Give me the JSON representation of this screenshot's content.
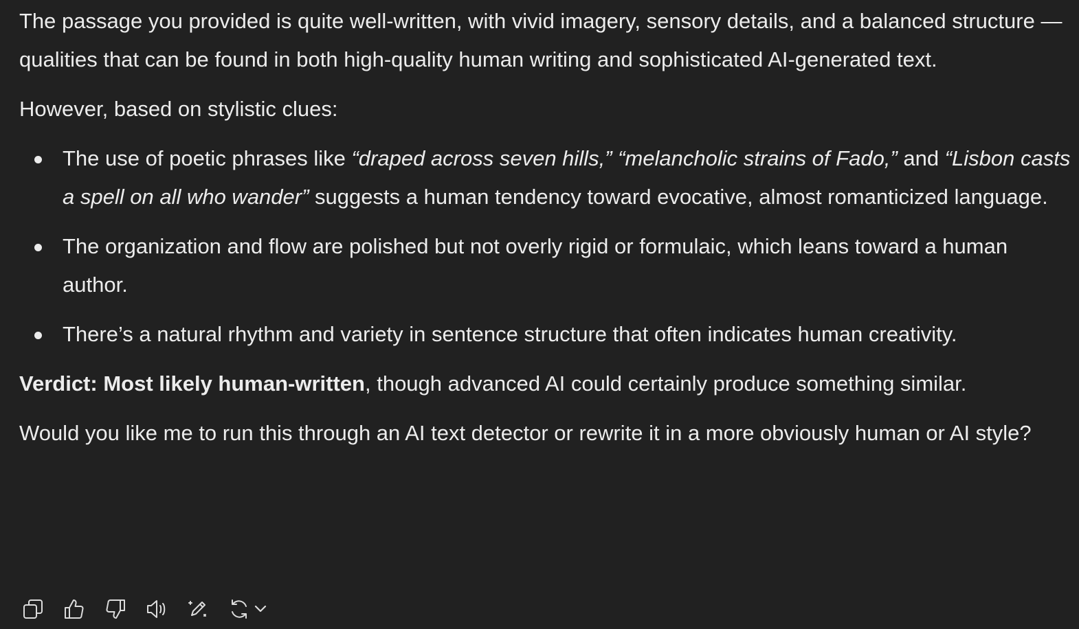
{
  "message": {
    "intro": "The passage you provided is quite well-written, with vivid imagery, sensory details, and a balanced structure — qualities that can be found in both high-quality human writing and sophisticated AI-generated text.",
    "however": "However, based on stylistic clues:",
    "bullets": [
      {
        "prefix": "The use of poetic phrases like ",
        "quote1": "“draped across seven hills,”",
        "sep1": " ",
        "quote2": "“melancholic strains of Fado,”",
        "sep2": " and ",
        "quote3": "“Lisbon casts a spell on all who wander”",
        "suffix": " suggests a human tendency toward evocative, almost romanticized language."
      },
      {
        "text": "The organization and flow are polished but not overly rigid or formulaic, which leans toward a human author."
      },
      {
        "text": "There’s a natural rhythm and variety in sentence structure that often indicates human creativity."
      }
    ],
    "verdict_bold": "Verdict: Most likely human-written",
    "verdict_rest": ", though advanced AI could certainly produce something similar.",
    "closing": "Would you like me to run this through an AI text detector or rewrite it in a more obviously human or AI style?"
  },
  "actions": {
    "icons": [
      "copy-icon",
      "thumbs-up-icon",
      "thumbs-down-icon",
      "read-aloud-icon",
      "edit-icon",
      "regenerate-icon",
      "chevron-down-icon"
    ]
  },
  "colors": {
    "background": "#212121",
    "text": "#ececec",
    "icon": "#dcdcdc"
  }
}
